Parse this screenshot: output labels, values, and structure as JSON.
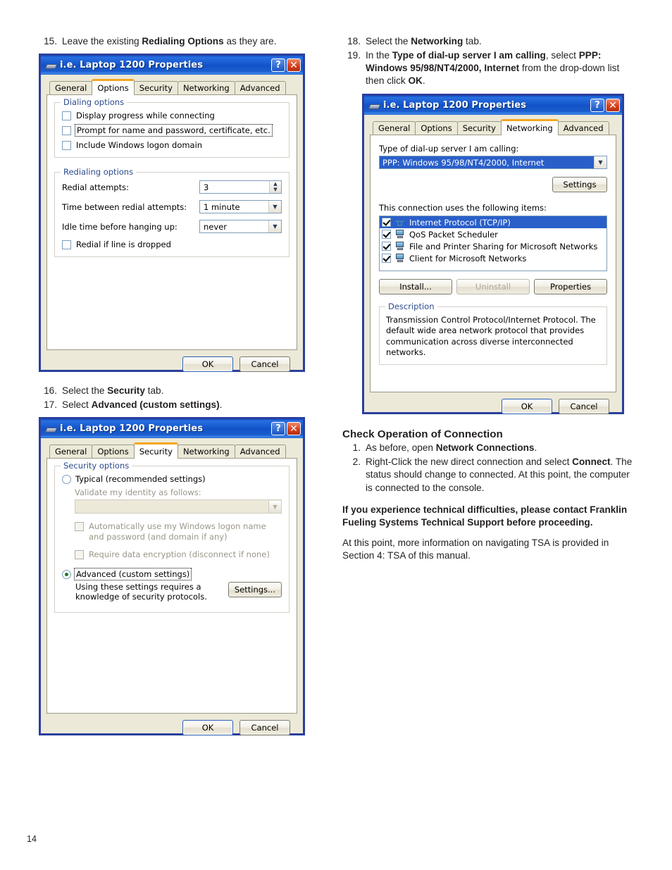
{
  "page": {
    "number": "14"
  },
  "left_column": {
    "step15": {
      "num": "15.",
      "text_before": "Leave the existing ",
      "bold": "Redialing Options",
      "text_after": " as they are."
    },
    "step16": {
      "num": "16.",
      "text_before": "Select the ",
      "bold": "Security",
      "text_after": " tab."
    },
    "step17": {
      "num": "17.",
      "text_before": "Select ",
      "bold": "Advanced (custom settings)",
      "text_after": "."
    }
  },
  "right_column": {
    "step18": {
      "num": "18.",
      "text_before": "Select the ",
      "bold": "Networking",
      "text_after": " tab."
    },
    "step19": {
      "num": "19.",
      "text_before": "In the ",
      "bold1": "Type of dial-up server I am calling",
      "text_mid": ", select ",
      "bold2": "PPP: Windows 95/98/NT4/2000, Internet",
      "text_mid2": " from the drop-down list then click ",
      "bold3": "OK",
      "text_after": "."
    },
    "check_operation": {
      "heading": "Check Operation of Connection",
      "items": [
        {
          "num": "1.",
          "text_before": "As before, open ",
          "bold": "Network Connections",
          "text_after": "."
        },
        {
          "num": "2.",
          "text_before": "Right-Click the new direct connection and select ",
          "bold": "Connect",
          "text_after": ". The status should change to connected. At this point, the computer is connected to the console."
        }
      ],
      "warning": "If you experience technical difficulties, please contact Franklin Fueling Systems Technical Support before proceeding.",
      "closing": "At this point, more information on navigating TSA is provided in Section 4: TSA of this manual."
    }
  },
  "dialog_common": {
    "title": "i.e.  Laptop 1200 Properties",
    "help_button": "?",
    "close_button": "✕",
    "tabs": [
      "General",
      "Options",
      "Security",
      "Networking",
      "Advanced"
    ],
    "ok": "OK",
    "cancel": "Cancel"
  },
  "dialog_options": {
    "active_tab": "Options",
    "dialing_options": {
      "title": "Dialing options",
      "checkboxes": [
        {
          "label": "Display progress while connecting",
          "checked": false,
          "focused": false
        },
        {
          "label": "Prompt for name and password, certificate, etc.",
          "checked": false,
          "focused": true
        },
        {
          "label": "Include Windows logon domain",
          "checked": false,
          "focused": false
        }
      ]
    },
    "redialing_options": {
      "title": "Redialing options",
      "redial_attempts_label": "Redial attempts:",
      "redial_attempts_value": "3",
      "time_between_label": "Time between redial attempts:",
      "time_between_value": "1 minute",
      "idle_time_label": "Idle time before hanging up:",
      "idle_time_value": "never",
      "redial_dropped_label": "Redial if line is dropped",
      "redial_dropped_checked": false
    }
  },
  "dialog_security": {
    "active_tab": "Security",
    "security_options": {
      "title": "Security options",
      "typical_label": "Typical (recommended settings)",
      "typical_selected": false,
      "validate_label": "Validate my identity as follows:",
      "validate_value": "",
      "auto_logon_label": "Automatically use my Windows logon name and password (and domain if any)",
      "auto_logon_checked": false,
      "require_encryption_label": "Require data encryption (disconnect if none)",
      "require_encryption_checked": false,
      "advanced_label": "Advanced (custom settings)",
      "advanced_selected": true,
      "advanced_description": "Using these settings requires a knowledge of security protocols.",
      "settings_button": "Settings..."
    }
  },
  "dialog_networking": {
    "active_tab": "Networking",
    "server_type_label": "Type of dial-up server I am calling:",
    "server_type_value": "PPP: Windows 95/98/NT4/2000, Internet",
    "settings_button": "Settings",
    "items_label": "This connection uses the following items:",
    "items": [
      {
        "label": "Internet Protocol (TCP/IP)",
        "checked": true,
        "selected": true,
        "icon": "network-protocol-icon"
      },
      {
        "label": "QoS Packet Scheduler",
        "checked": true,
        "selected": false,
        "icon": "monitor-icon"
      },
      {
        "label": "File and Printer Sharing for Microsoft Networks",
        "checked": true,
        "selected": false,
        "icon": "monitor-icon"
      },
      {
        "label": "Client for Microsoft Networks",
        "checked": true,
        "selected": false,
        "icon": "monitor-icon"
      }
    ],
    "install_button": "Install...",
    "uninstall_button": "Uninstall",
    "uninstall_disabled": true,
    "properties_button": "Properties",
    "description_title": "Description",
    "description_text": "Transmission Control Protocol/Internet Protocol. The default wide area network protocol that provides communication across diverse interconnected networks."
  },
  "colors": {
    "title_bar_blue": "#1759cf",
    "dialog_border": "#2a3f9d",
    "dialog_face": "#ece9d8",
    "active_tab_accent": "#f5a623",
    "selection_blue": "#2a5fc9",
    "group_label": "#2b4a8b",
    "text": "#231f20"
  }
}
